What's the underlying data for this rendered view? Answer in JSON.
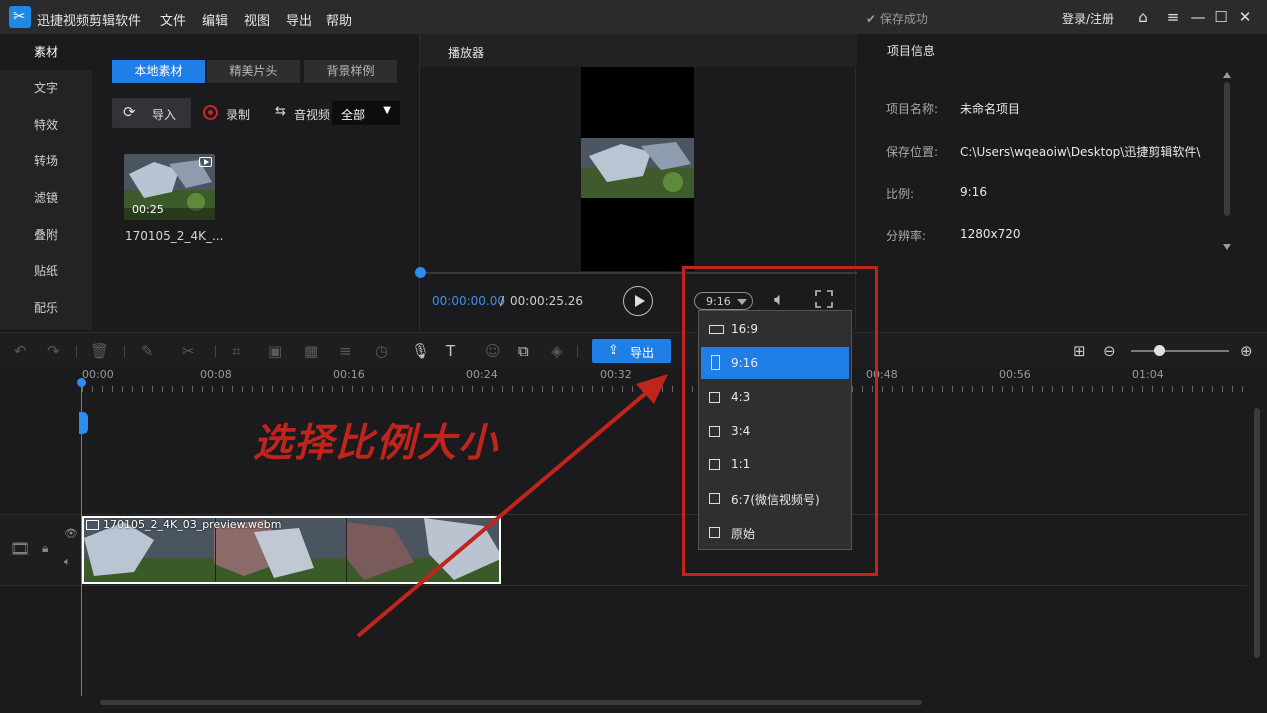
{
  "titlebar": {
    "app_name": "迅捷视频剪辑软件",
    "menus": [
      "文件",
      "编辑",
      "视图",
      "导出",
      "帮助"
    ],
    "save_status": "✔ 保存成功",
    "login": "登录/注册"
  },
  "leftnav": {
    "items": [
      "素材",
      "文字",
      "特效",
      "转场",
      "滤镜",
      "叠附",
      "贴纸",
      "配乐"
    ]
  },
  "media": {
    "tabs": [
      "本地素材",
      "精美片头",
      "背景样例"
    ],
    "import": "导入",
    "record": "录制",
    "av": "音视频",
    "filter": "全部",
    "thumb_duration": "00:25",
    "thumb_name": "170105_2_4K_..."
  },
  "player": {
    "title": "播放器",
    "time_current": "00:00:00.00",
    "time_sep": "/",
    "time_total": "00:00:25.26",
    "ratio": "9:16",
    "progress": 0
  },
  "info": {
    "title": "项目信息",
    "rows": [
      {
        "label": "项目名称:",
        "value": "未命名项目"
      },
      {
        "label": "保存位置:",
        "value": "C:\\Users\\wqeaoiw\\Desktop\\迅捷剪辑软件\\"
      },
      {
        "label": "比例:",
        "value": "9:16"
      },
      {
        "label": "分辨率:",
        "value": "1280x720"
      }
    ]
  },
  "toolbar": {
    "export": "导出"
  },
  "timeline": {
    "ruler": [
      "00:00",
      "00:08",
      "00:16",
      "00:24",
      "00:32",
      "00:48",
      "00:56",
      "01:04"
    ],
    "clip_name": "170105_2_4K_03_preview.webm"
  },
  "ratio_menu": {
    "items": [
      "16:9",
      "9:16",
      "4:3",
      "3:4",
      "1:1",
      "6:7(微信视频号)",
      "原始"
    ],
    "selected": "9:16"
  },
  "annotation": {
    "text": "选择比例大小"
  },
  "colors": {
    "accent": "#1f7fe6",
    "annotation_red": "#c0241c"
  }
}
